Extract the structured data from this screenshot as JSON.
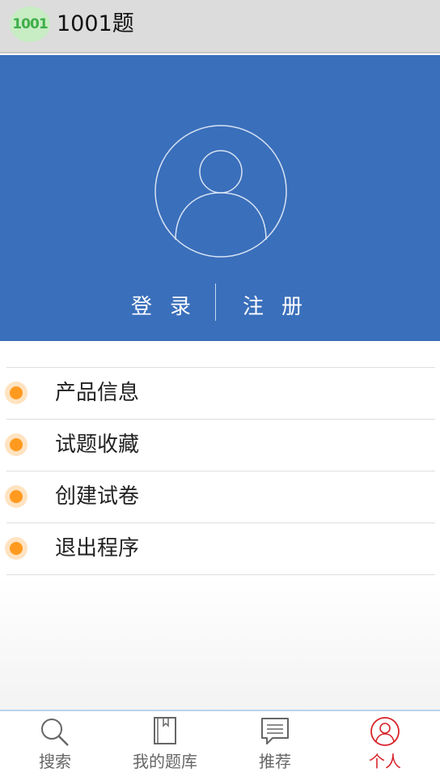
{
  "appbar": {
    "logo_text": "1001",
    "title": "1001题"
  },
  "hero": {
    "login_label": "登录",
    "register_label": "注册",
    "color": "#3a6fbb",
    "avatar_icon": "user-avatar-outline-icon"
  },
  "menu": {
    "items": [
      {
        "label": "产品信息",
        "icon": "orange-dot-icon"
      },
      {
        "label": "试题收藏",
        "icon": "orange-dot-icon"
      },
      {
        "label": "创建试卷",
        "icon": "orange-dot-icon"
      },
      {
        "label": "退出程序",
        "icon": "orange-dot-icon"
      }
    ],
    "bullet_color": "#ff9a1f"
  },
  "tabbar": {
    "tabs": [
      {
        "label": "搜索",
        "icon": "search-icon",
        "active": false
      },
      {
        "label": "我的题库",
        "icon": "book-icon",
        "active": false
      },
      {
        "label": "推荐",
        "icon": "message-icon",
        "active": false
      },
      {
        "label": "个人",
        "icon": "user-icon",
        "active": true
      }
    ],
    "active_color": "#d8232a"
  }
}
